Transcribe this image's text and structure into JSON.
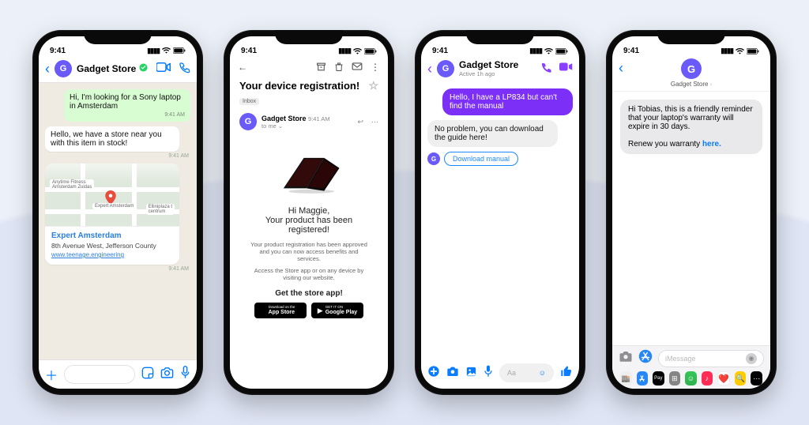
{
  "status_time": "9:41",
  "store_name": "Gadget Store",
  "avatar_letter": "G",
  "phone1": {
    "title": "Gadget Store",
    "msg_out": "Hi, I'm looking for a Sony laptop in Amsterdam",
    "msg_out_ts": "9:41 AM",
    "msg_in": "Hello, we have a store near you with this item in stock!",
    "msg_in_ts": "9:41 AM",
    "map_title": "Expert Amsterdam",
    "map_addr": "8th Avenue West, Jefferson County",
    "map_link": "www.teenage.engineering",
    "map_ts": "9:41 AM",
    "map_pin_label": "Expert Amsterdam"
  },
  "phone2": {
    "subject": "Your device registration!",
    "inbox_label": "Inbox",
    "from": "Gadget Store",
    "from_time": "9:41 AM",
    "to_line": "to me",
    "greet1": "Hi Maggie,",
    "greet2": "Your product has been registered!",
    "para1": "Your product registration has been approved and you can now access benefits and services.",
    "para2": "Access the Store app or on any device by visiting our website.",
    "cta": "Get the store app!",
    "badge1_top": "Download on the",
    "badge1": "App Store",
    "badge2_top": "GET IT ON",
    "badge2": "Google Play"
  },
  "phone3": {
    "title": "Gadget Store",
    "subtitle": "Active 1h ago",
    "msg_out": "Hello, I have a LP834 but can't find the manual",
    "msg_in": "No problem, you can download the guide here!",
    "chip": "Download manual",
    "input_placeholder": "Aa"
  },
  "phone4": {
    "title": "Gadget Store",
    "bubble_a": "Hi Tobias, this is a friendly reminder that your laptop's warranty will expire in 30 days.",
    "bubble_b_pre": "Renew you warranty ",
    "bubble_b_link": "here",
    "input_placeholder": "iMessage"
  }
}
